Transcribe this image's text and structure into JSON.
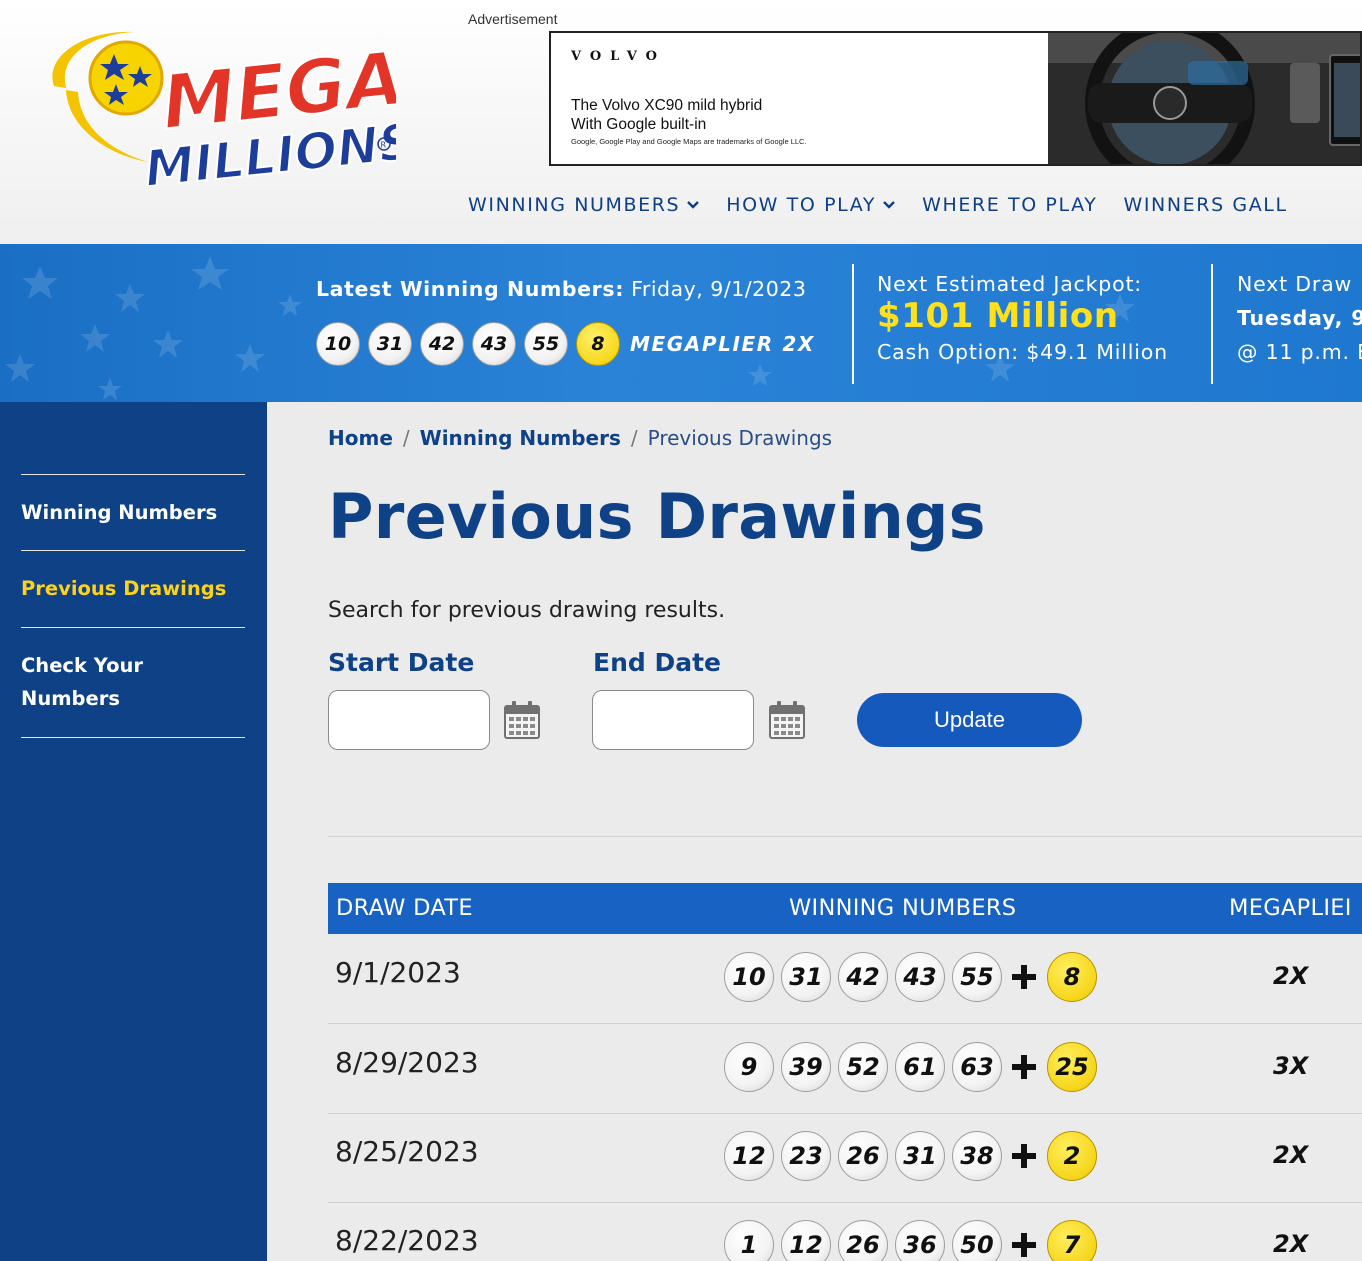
{
  "ad": {
    "label": "Advertisement",
    "brand": "VOLVO",
    "line1": "The Volvo XC90 mild hybrid",
    "line2": "With Google built-in",
    "fine_print": "Google, Google Play and Google Maps are trademarks of Google LLC."
  },
  "nav": {
    "items": [
      {
        "label": "WINNING NUMBERS",
        "dropdown": true
      },
      {
        "label": "HOW TO PLAY",
        "dropdown": true
      },
      {
        "label": "WHERE TO PLAY",
        "dropdown": false
      },
      {
        "label": "WINNERS GALL",
        "dropdown": false
      }
    ]
  },
  "banner": {
    "latest_label": "Latest Winning Numbers:",
    "latest_date": "Friday, 9/1/2023",
    "balls": [
      "10",
      "31",
      "42",
      "43",
      "55"
    ],
    "mega_ball": "8",
    "megaplier": "MEGAPLIER 2X",
    "jackpot_label": "Next Estimated Jackpot:",
    "jackpot_amount": "$101 Million",
    "cash_option": "Cash Option: $49.1 Million",
    "next_draw_label": "Next Draw",
    "next_draw_day": "Tuesday, 9",
    "next_draw_time": "@ 11 p.m. E"
  },
  "sidebar": {
    "items": [
      {
        "label": "Winning Numbers",
        "active": false
      },
      {
        "label": "Previous Drawings",
        "active": true
      },
      {
        "label_line1": "Check Your",
        "label_line2": "Numbers",
        "active": false
      }
    ]
  },
  "breadcrumb": {
    "home": "Home",
    "winning_numbers": "Winning Numbers",
    "current": "Previous Drawings"
  },
  "page": {
    "title": "Previous Drawings",
    "intro": "Search for previous drawing results."
  },
  "search": {
    "start_label": "Start Date",
    "start_value": "",
    "end_label": "End Date",
    "end_value": "",
    "update_label": "Update"
  },
  "table": {
    "headers": {
      "date": "DRAW DATE",
      "numbers": "WINNING NUMBERS",
      "megaplier": "MEGAPLIEI"
    },
    "rows": [
      {
        "date": "9/1/2023",
        "balls": [
          "10",
          "31",
          "42",
          "43",
          "55"
        ],
        "mega_ball": "8",
        "megaplier": "2X"
      },
      {
        "date": "8/29/2023",
        "balls": [
          "9",
          "39",
          "52",
          "61",
          "63"
        ],
        "mega_ball": "25",
        "megaplier": "3X"
      },
      {
        "date": "8/25/2023",
        "balls": [
          "12",
          "23",
          "26",
          "31",
          "38"
        ],
        "mega_ball": "2",
        "megaplier": "2X"
      },
      {
        "date": "8/22/2023",
        "balls": [
          "1",
          "12",
          "26",
          "36",
          "50"
        ],
        "mega_ball": "7",
        "megaplier": "2X"
      }
    ]
  },
  "colors": {
    "brand_blue": "#0e4185",
    "banner_blue": "#1f78cf",
    "table_header_blue": "#1762c2",
    "accent_yellow": "#ffd21a",
    "button_blue": "#1559bd"
  }
}
